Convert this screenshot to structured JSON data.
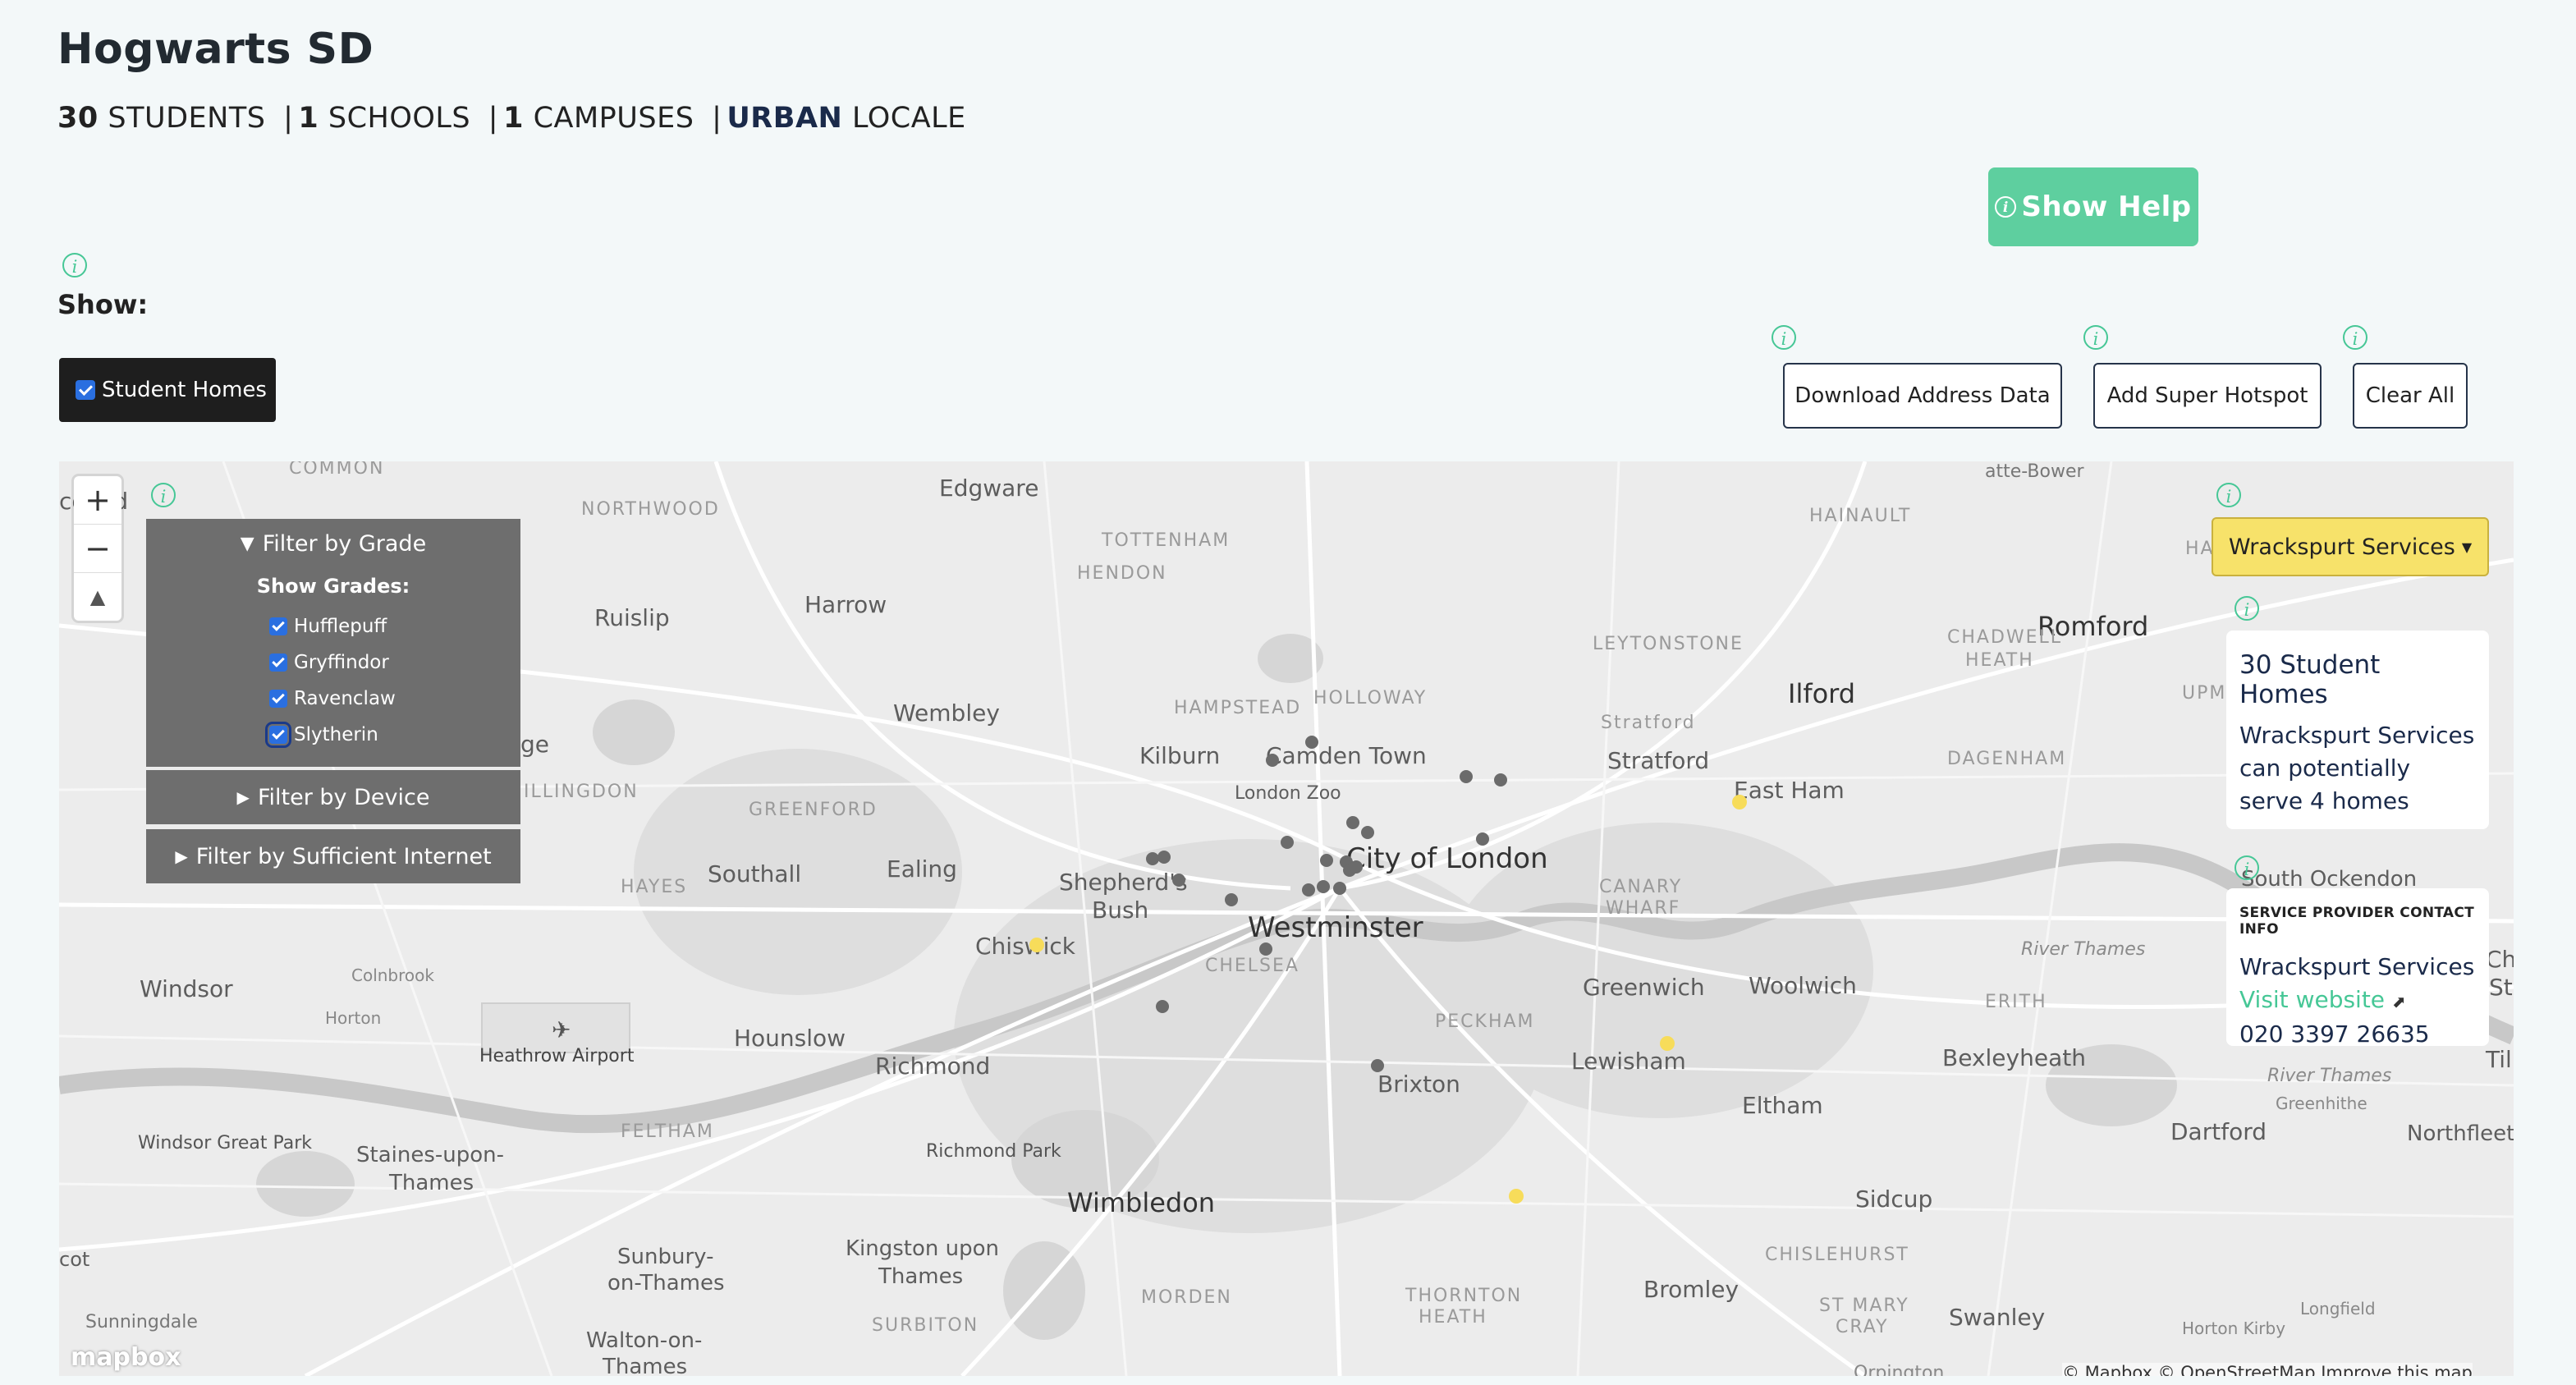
{
  "header": {
    "title": "Hogwarts SD",
    "stats": {
      "students_num": "30",
      "students_label": "STUDENTS",
      "schools_num": "1",
      "schools_label": "SCHOOLS",
      "campuses_num": "1",
      "campuses_label": "CAMPUSES",
      "locale_value": "URBAN",
      "locale_label": "LOCALE"
    }
  },
  "help_button": {
    "label": "Show Help",
    "icon": "info-icon"
  },
  "show": {
    "label": "Show:",
    "student_homes_label": "Student Homes",
    "student_homes_checked": true
  },
  "actions": {
    "download": "Download Address Data",
    "add_hotspot": "Add Super Hotspot",
    "clear_all": "Clear All"
  },
  "map": {
    "zoom_in": "+",
    "zoom_out": "−",
    "compass": "▲",
    "filters": {
      "grade_title": "Filter by Grade",
      "show_grades": "Show Grades:",
      "grades": [
        {
          "label": "Hufflepuff",
          "checked": true
        },
        {
          "label": "Gryffindor",
          "checked": true
        },
        {
          "label": "Ravenclaw",
          "checked": true
        },
        {
          "label": "Slytherin",
          "checked": true
        }
      ],
      "device_title": "Filter by Device",
      "internet_title": "Filter by Sufficient Internet"
    },
    "provider_select": "Wrackspurt Services",
    "homes_card": {
      "title": "30 Student Homes",
      "description": "Wrackspurt Services can potentially serve 4 homes"
    },
    "contact_card": {
      "heading": "SERVICE PROVIDER CONTACT INFO",
      "name": "Wrackspurt Services",
      "link": "Visit website",
      "phone": "020 3397 26635"
    },
    "places": {
      "edgware": "Edgware",
      "harrow": "Harrow",
      "ruislip": "Ruislip",
      "wembley": "Wembley",
      "kilburn": "Kilburn",
      "camden": "Camden Town",
      "london_zoo": "London Zoo",
      "city": "City of London",
      "westminster": "Westminster",
      "shepherds": "Shepherd's",
      "bush": "Bush",
      "ealing": "Ealing",
      "southall": "Southall",
      "chiswick": "Chiswick",
      "stratford": "Stratford",
      "eastham": "East Ham",
      "ilford": "Ilford",
      "romford": "Romford",
      "greenwich": "Greenwich",
      "woolwich": "Woolwich",
      "lewisham": "Lewisham",
      "brixton": "Brixton",
      "richmond": "Richmond",
      "hounslow": "Hounslow",
      "windsor": "Windsor",
      "heathrow": "Heathrow Airport",
      "wimbledon": "Wimbledon",
      "kingston": "Kingston upon",
      "thames": "Thames",
      "bexleyheath": "Bexleyheath",
      "eltham": "Eltham",
      "sidcup": "Sidcup",
      "bromley": "Bromley",
      "dartford": "Dartford",
      "northfleet": "Northfleet",
      "swanley": "Swanley",
      "sunbury": "Sunbury-",
      "onthames": "on-Thames",
      "staines": "Staines-upon-",
      "staines2": "Thames",
      "windsor_park": "Windsor Great Park",
      "richmond_park": "Richmond Park",
      "walton": "Walton-on-",
      "walton2": "Thames",
      "sunningdale": "Sunningdale",
      "tottenham": "TOTTENHAM",
      "hendon": "HENDON",
      "hampstead": "HAMPSTEAD",
      "holloway": "HOLLOWAY",
      "leytonstone": "LEYTONSTONE",
      "hainault": "HAINAULT",
      "chadwell": "CHADWELL",
      "heath": "HEATH",
      "dagenham": "DAGENHAM",
      "greenford": "GREENFORD",
      "hayes": "HAYES",
      "hillingdon": "ILLINGDON",
      "northwood": "NORTHWOOD",
      "common": "COMMON",
      "feltham": "FELTHAM",
      "chelsea": "CHELSEA",
      "peckham": "PECKHAM",
      "erith": "ERITH",
      "morden": "MORDEN",
      "thornton": "THORNTON",
      "heath2": "HEATH",
      "surbiton": "SURBITON",
      "chislehurst": "CHISLEHURST",
      "stmary": "ST MARY",
      "cray": "CRAY",
      "canary": "CANARY",
      "wharf": "WHARF",
      "river_thames": "River Thames",
      "river_thames2": "River Thames",
      "greenhithe": "Greenhithe",
      "south_ockendon": "South Ockendon",
      "colnbrook": "Colnbrook",
      "horton": "Horton",
      "horton_kirby": "Horton Kirby",
      "longfield": "Longfield",
      "atte_bower": "atte-Bower",
      "upm": "UPM",
      "harc": "HARC",
      "ge": "ge",
      "cot": "cot",
      "co_eld": "co  eld",
      "st": "St",
      "cha": "Cha",
      "til": "Til",
      "orpington": "Orpington"
    },
    "logo": "mapbox",
    "attribution": "© Mapbox © OpenStreetMap  Improve this map"
  }
}
